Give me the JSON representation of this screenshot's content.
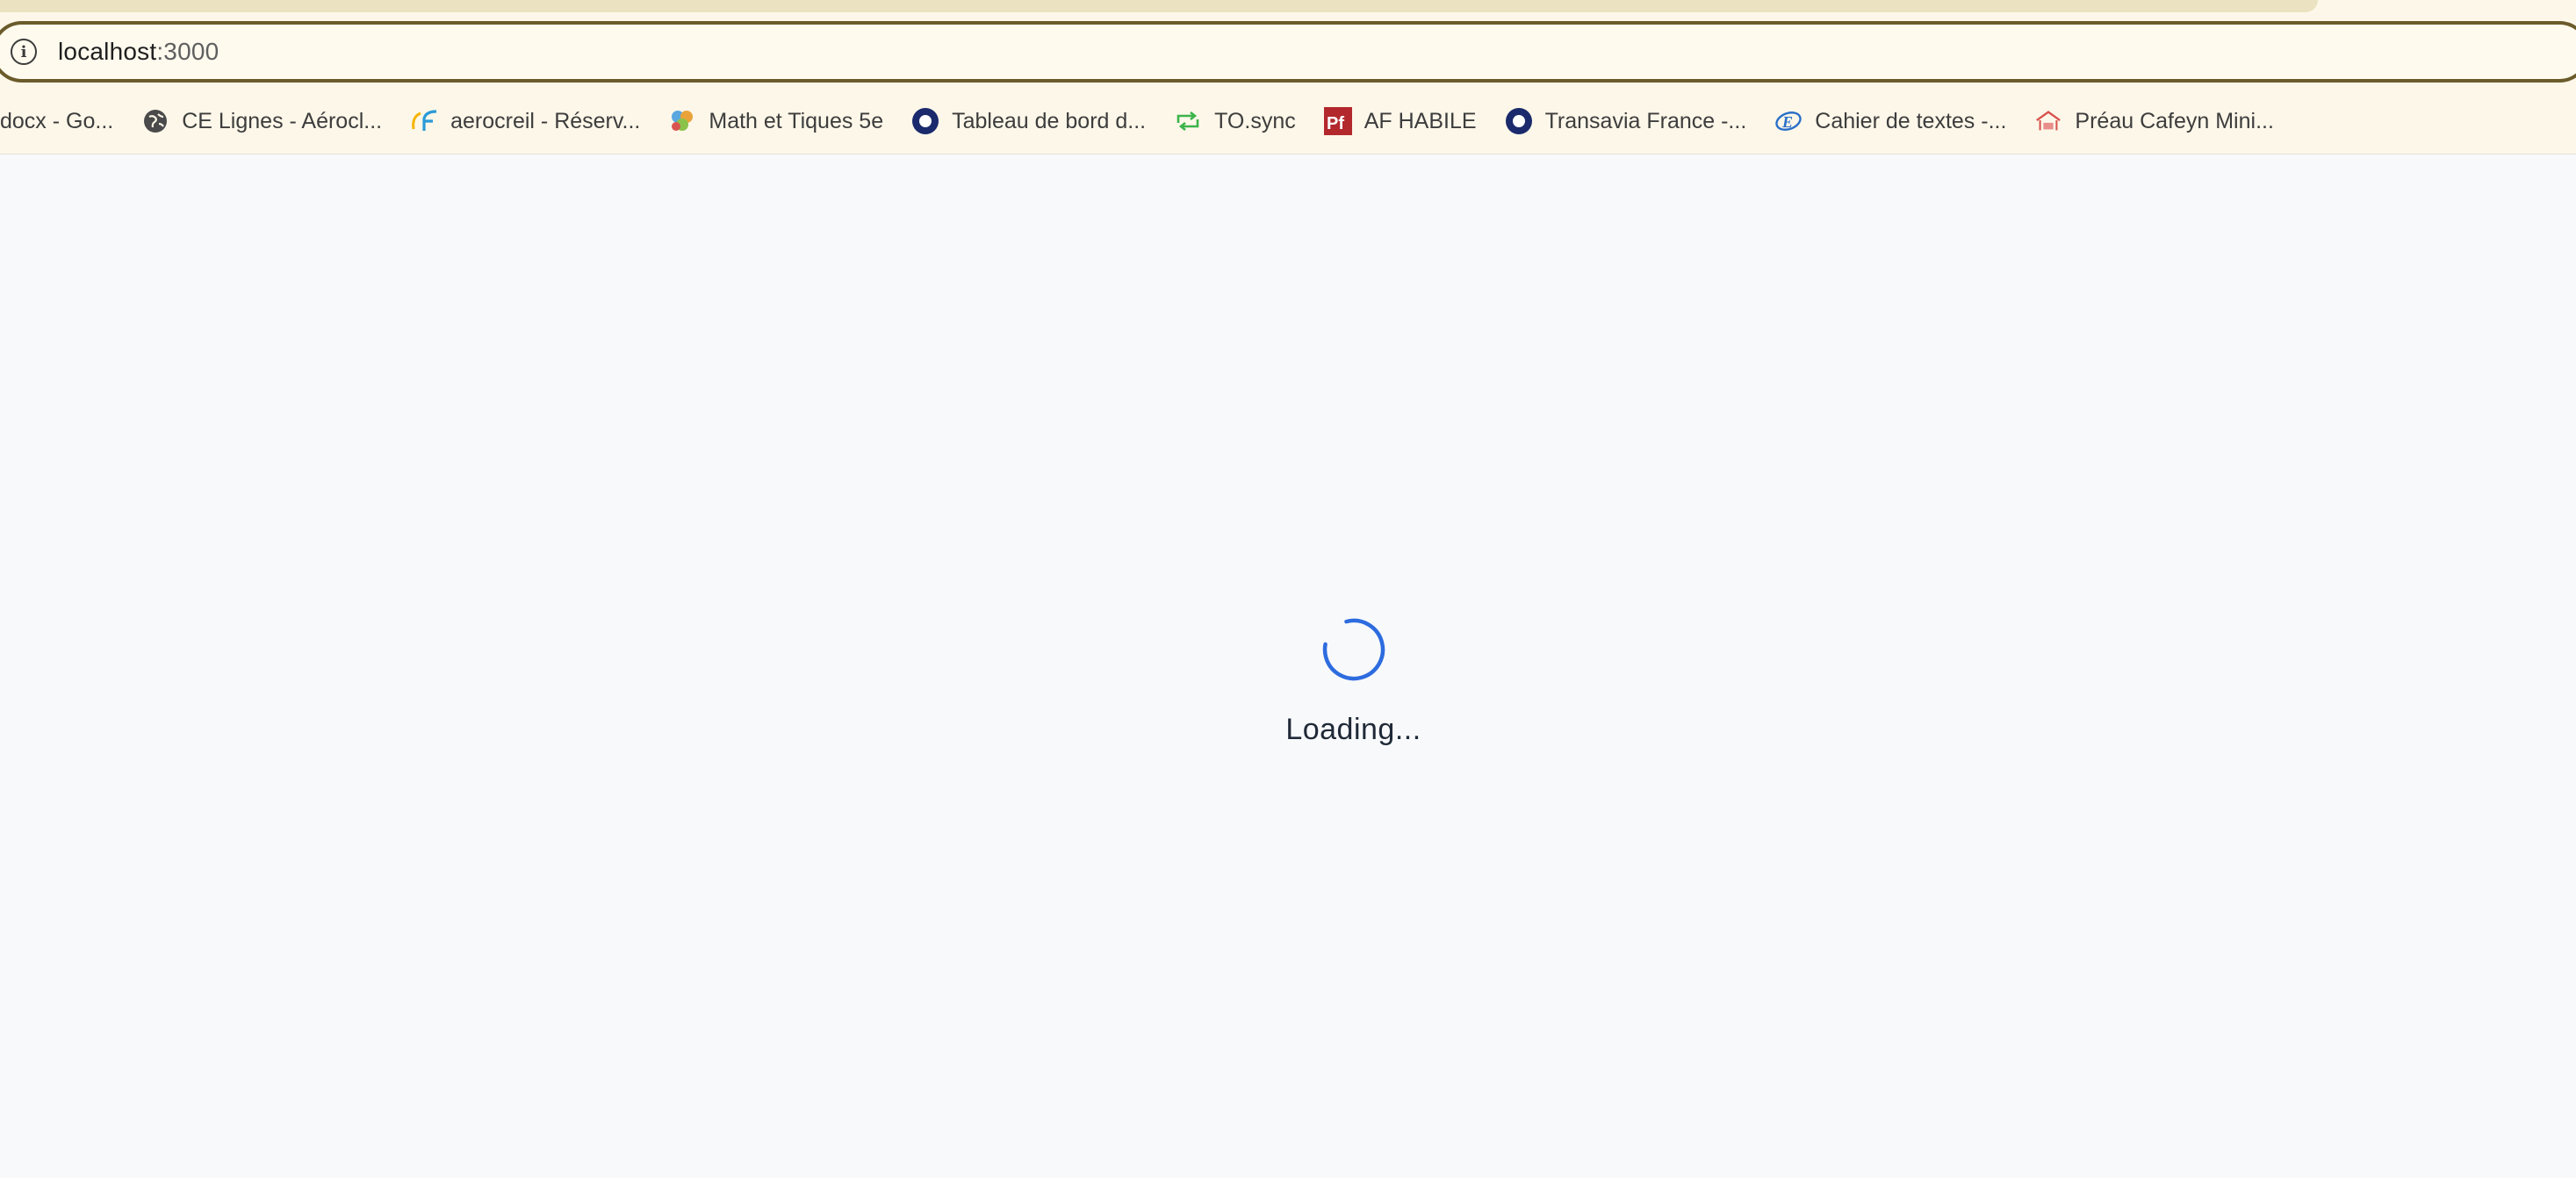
{
  "browser": {
    "url_host": "localhost",
    "url_port": ":3000",
    "site_info_icon": "info-icon",
    "bookmarks": [
      {
        "label": "docx - Go...",
        "icon": "docs-icon"
      },
      {
        "label": "CE Lignes - Aérocl...",
        "icon": "globe-icon"
      },
      {
        "label": "aerocreil - Réserv...",
        "icon": "aerocreil-icon"
      },
      {
        "label": "Math et Tiques 5e",
        "icon": "mathetiques-icon"
      },
      {
        "label": "Tableau de bord d...",
        "icon": "circle-badge-icon"
      },
      {
        "label": "TO.sync",
        "icon": "sync-arrows-icon"
      },
      {
        "label": "AF HABILE",
        "icon": "pf-icon"
      },
      {
        "label": "Transavia France -...",
        "icon": "circle-badge-icon"
      },
      {
        "label": "Cahier de textes -...",
        "icon": "ecole-directe-icon"
      },
      {
        "label": "Préau Cafeyn Mini...",
        "icon": "preau-icon"
      }
    ]
  },
  "page": {
    "loading_text": "Loading...",
    "spinner_color": "#2d6cdf"
  },
  "colors": {
    "omnibox_border": "#6b5b2a",
    "toolbar_bg": "#fdf7e9",
    "page_bg": "#f8f9fb"
  }
}
